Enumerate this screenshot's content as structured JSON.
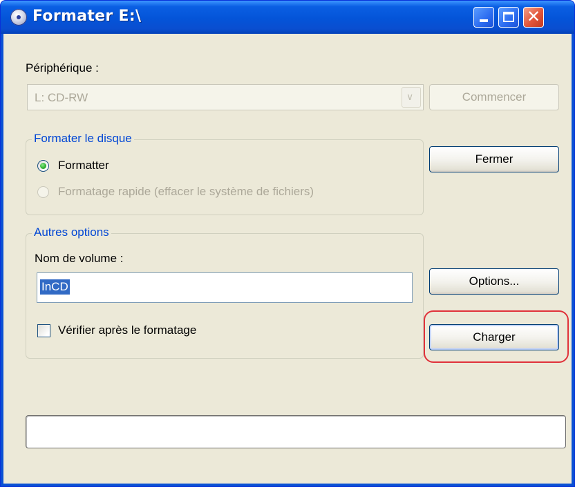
{
  "window": {
    "title": "Formater E:\\",
    "icon": "disc-icon"
  },
  "device": {
    "label": "Périphérique :",
    "value": "L: CD-RW"
  },
  "buttons": {
    "start_label": "Commencer",
    "close_label": "Fermer",
    "options_label": "Options...",
    "load_label": "Charger"
  },
  "format_group": {
    "title": "Formater le disque",
    "option_full": "Formatter",
    "option_quick": "Formatage rapide (effacer le système de fichiers)"
  },
  "other_group": {
    "title": "Autres options",
    "volume_label": "Nom de volume :",
    "volume_value": "InCD",
    "verify_label": "Vérifier après le formatage"
  },
  "progress": {
    "fraction": 0
  },
  "colors": {
    "titlebar": "#0454d8",
    "dialog_bg": "#ece9d8",
    "group_title": "#0046d5",
    "highlight_ring": "#e0313a",
    "selection": "#316ac5"
  }
}
